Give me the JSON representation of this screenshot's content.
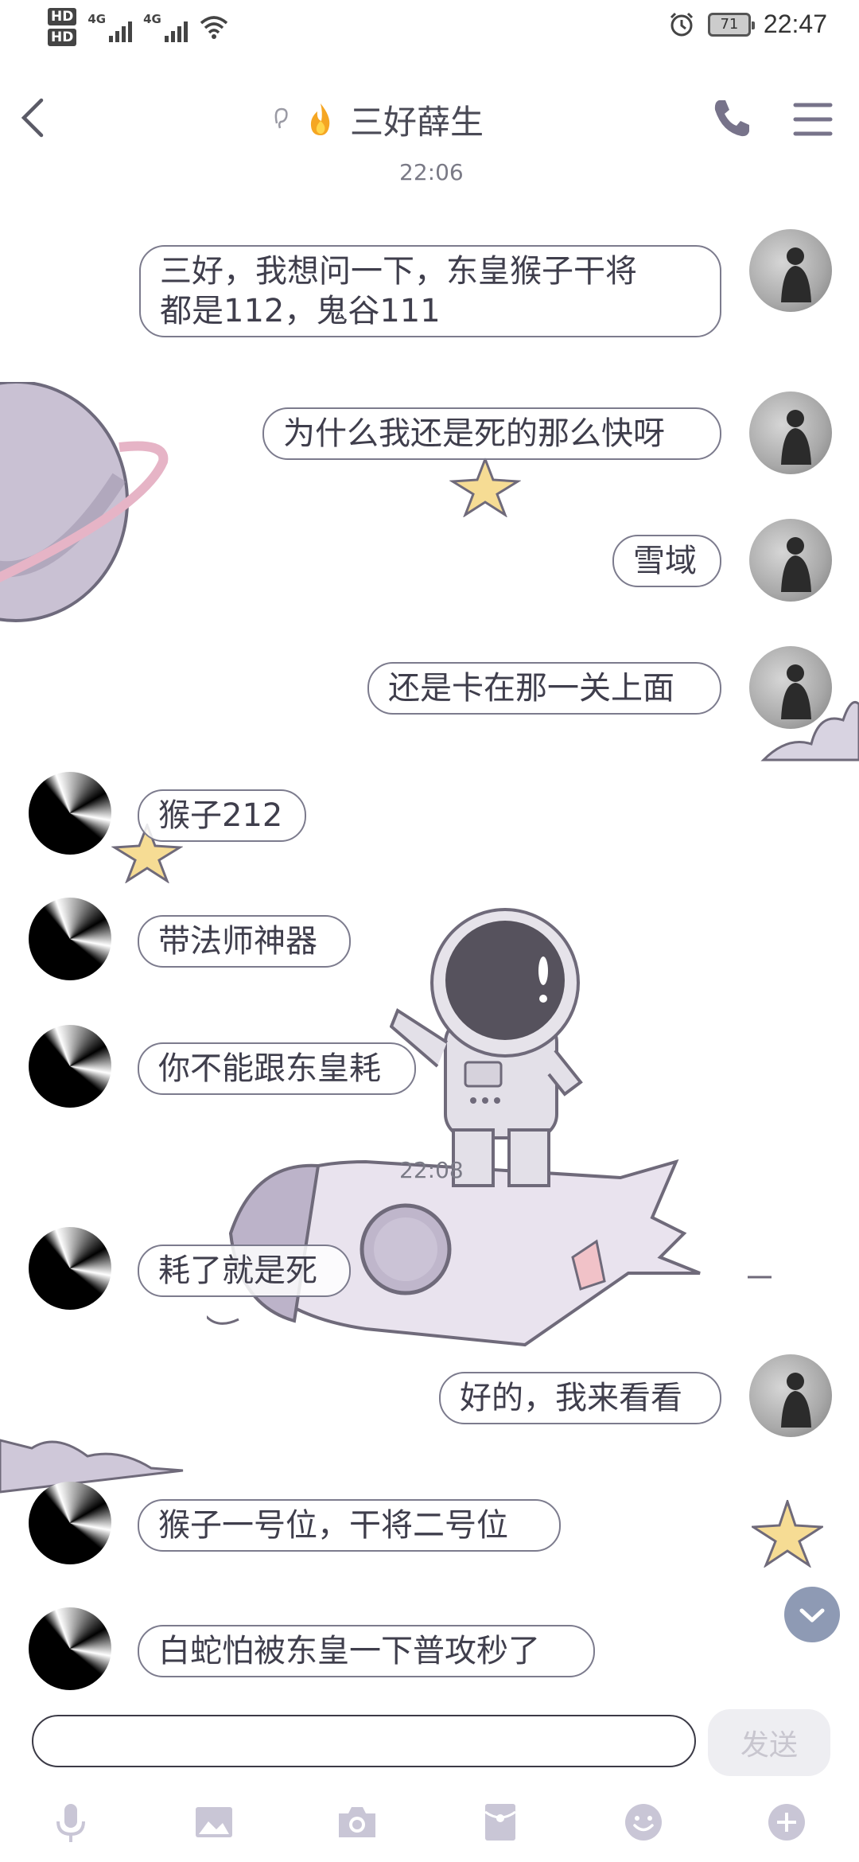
{
  "status_bar": {
    "hd1": "HD",
    "hd2": "HD",
    "net1": "4G",
    "net2": "4G",
    "battery": "71",
    "clock": "22:47"
  },
  "header": {
    "title": "三好薛生"
  },
  "chat": {
    "time_1": "22:06",
    "time_2": "22:08",
    "messages": [
      {
        "from": "me",
        "text": "三好，我想问一下，东皇猴子干将\n都是112，鬼谷111"
      },
      {
        "from": "me",
        "text": "为什么我还是死的那么快呀"
      },
      {
        "from": "me",
        "text": "雪域"
      },
      {
        "from": "me",
        "text": "还是卡在那一关上面"
      },
      {
        "from": "other",
        "text": "猴子212"
      },
      {
        "from": "other",
        "text": "带法师神器"
      },
      {
        "from": "other",
        "text": "你不能跟东皇耗"
      },
      {
        "from": "other",
        "text": "耗了就是死"
      },
      {
        "from": "me",
        "text": "好的，我来看看"
      },
      {
        "from": "other",
        "text": "猴子一号位，干将二号位"
      },
      {
        "from": "other",
        "text": "白蛇怕被东皇一下普攻秒了"
      }
    ]
  },
  "input_bar": {
    "send_label": "发送"
  },
  "toolbar": {
    "icons": [
      "microphone-icon",
      "image-icon",
      "camera-icon",
      "red-packet-icon",
      "emoji-icon",
      "plus-icon"
    ]
  },
  "colors": {
    "bubble_border": "#7c7b8d",
    "scroll_button": "#8e9ab4",
    "send_disabled_bg": "#eeeef2"
  }
}
